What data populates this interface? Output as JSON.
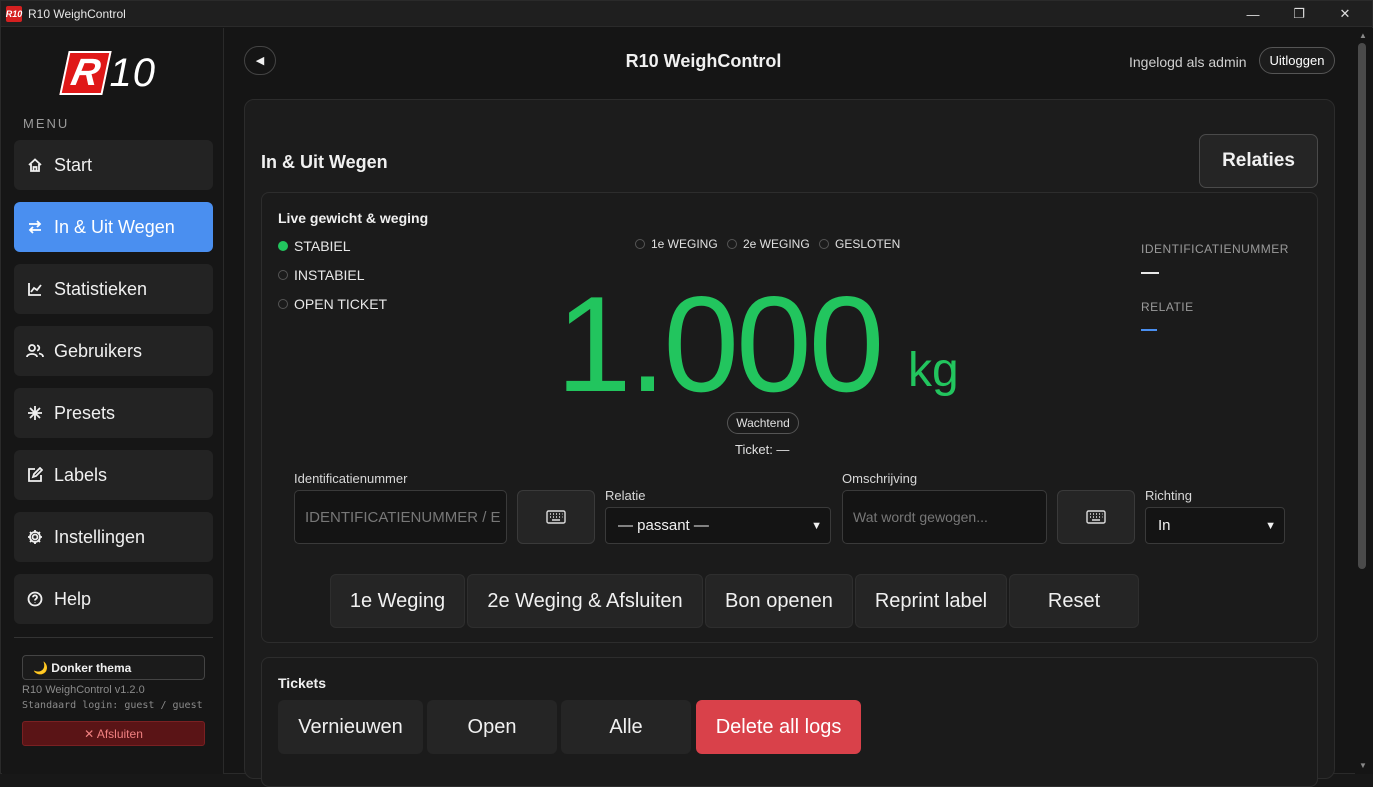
{
  "window": {
    "title": "R10 WeighControl",
    "controls": {
      "minimize": "—",
      "maximize": "❐",
      "close": "✕"
    }
  },
  "sidebar": {
    "logo_r": "R",
    "logo_num": "10",
    "menu_label": "MENU",
    "items": [
      {
        "label": "Start",
        "icon": "home-icon"
      },
      {
        "label": "In & Uit Wegen",
        "icon": "swap-icon",
        "active": true
      },
      {
        "label": "Statistieken",
        "icon": "chart-icon"
      },
      {
        "label": "Gebruikers",
        "icon": "users-icon"
      },
      {
        "label": "Presets",
        "icon": "asterisk-icon"
      },
      {
        "label": "Labels",
        "icon": "edit-icon"
      },
      {
        "label": "Instellingen",
        "icon": "gear-icon"
      },
      {
        "label": "Help",
        "icon": "help-icon"
      }
    ],
    "theme_button": "🌙 Donker thema",
    "version": "R10 WeighControl v1.2.0",
    "login_hint": "Standaard login: guest / guest",
    "quit_button": "✕ Afsluiten"
  },
  "header": {
    "back": "◀",
    "title": "R10 WeighControl",
    "logged_in": "Ingelogd als admin",
    "logout": "Uitloggen"
  },
  "main": {
    "title": "In & Uit Wegen",
    "relaties_button": "Relaties",
    "live": {
      "title": "Live gewicht & weging",
      "statuses": [
        {
          "label": "STABIEL",
          "active": true
        },
        {
          "label": "INSTABIEL",
          "active": false
        },
        {
          "label": "OPEN TICKET",
          "active": false
        }
      ],
      "phases": [
        "1e WEGING",
        "2e WEGING",
        "GESLOTEN"
      ],
      "weight": "1.000",
      "unit": "kg",
      "badge": "Wachtend",
      "ticket": "Ticket: —",
      "id_label": "IDENTIFICATIENUMMER",
      "relatie_label": "RELATIE",
      "status_color": "#22c55e"
    },
    "form": {
      "id_label": "Identificatienummer",
      "id_placeholder": "IDENTIFICATIENUMMER / E",
      "relatie_label": "Relatie",
      "relatie_value": "— passant —",
      "omschrijving_label": "Omschrijving",
      "omschrijving_placeholder": "Wat wordt gewogen...",
      "richting_label": "Richting",
      "richting_value": "In"
    },
    "actions": [
      "1e Weging",
      "2e Weging & Afsluiten",
      "Bon openen",
      "Reprint label",
      "Reset"
    ],
    "tickets": {
      "title": "Tickets",
      "buttons": [
        "Vernieuwen",
        "Open",
        "Alle",
        "Delete all logs"
      ],
      "danger_color": "#d9414a"
    }
  },
  "colors": {
    "accent": "#4a8ff0",
    "green": "#22c55e",
    "brand_red": "#e01818"
  }
}
